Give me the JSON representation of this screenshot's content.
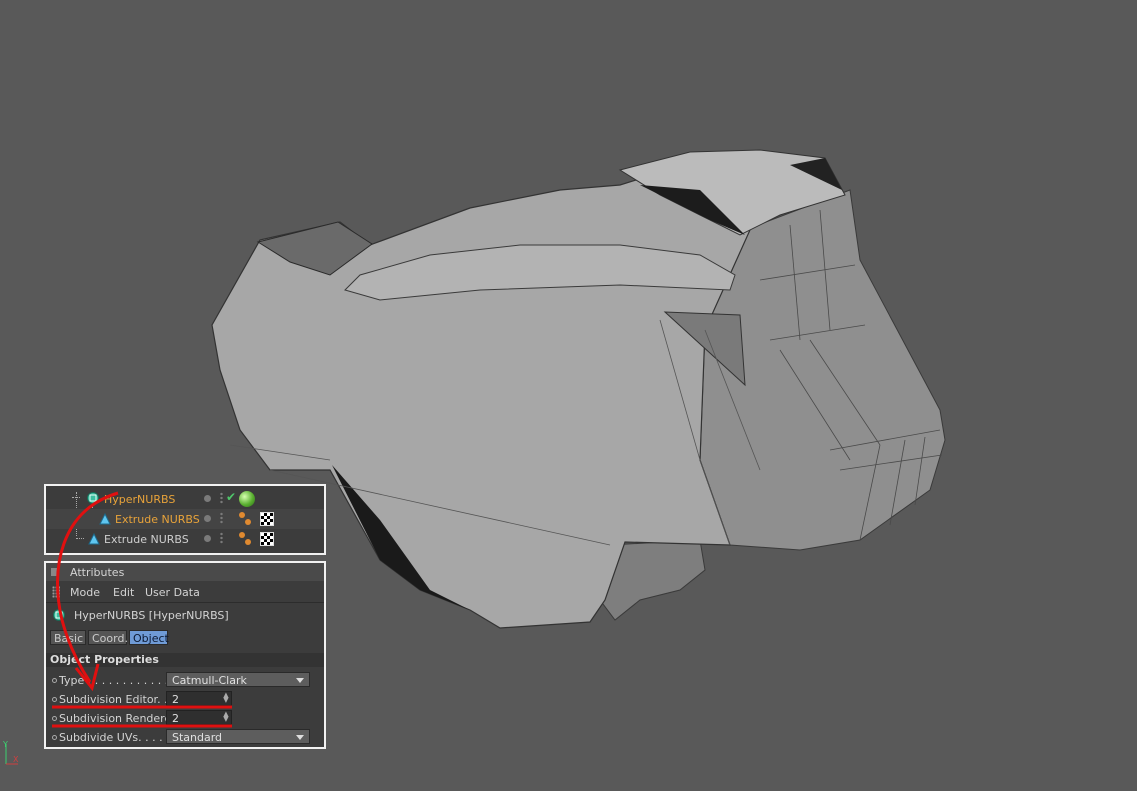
{
  "objects_panel": {
    "rows": [
      {
        "name": "HyperNURBS"
      },
      {
        "name": "Extrude NURBS"
      },
      {
        "name": "Extrude NURBS"
      }
    ]
  },
  "attributes_panel": {
    "header_title": "Attributes",
    "menu": [
      "Mode",
      "Edit",
      "User Data"
    ],
    "object_title": "HyperNURBS [HyperNURBS]",
    "tabs": [
      "Basic",
      "Coord.",
      "Object"
    ],
    "active_tab": "Object",
    "section_title": "Object Properties",
    "properties": [
      {
        "label": "Type . . . . . . . . . . . .",
        "value": "Catmull-Clark",
        "control": "dropdown"
      },
      {
        "label": "Subdivision Editor. . . .",
        "value": "2",
        "control": "spinner"
      },
      {
        "label": "Subdivision Renderer",
        "value": "2",
        "control": "spinner"
      },
      {
        "label": "Subdivide UVs. . . . . .",
        "value": "Standard",
        "control": "dropdown"
      }
    ]
  },
  "colors": {
    "viewport_bg": "#595959",
    "annotation_red": "#e01010",
    "active_object_name": "#e8a33a",
    "active_tab": "#6f9bd6"
  },
  "axis": {
    "y_label": "Y",
    "x_label": "X"
  }
}
